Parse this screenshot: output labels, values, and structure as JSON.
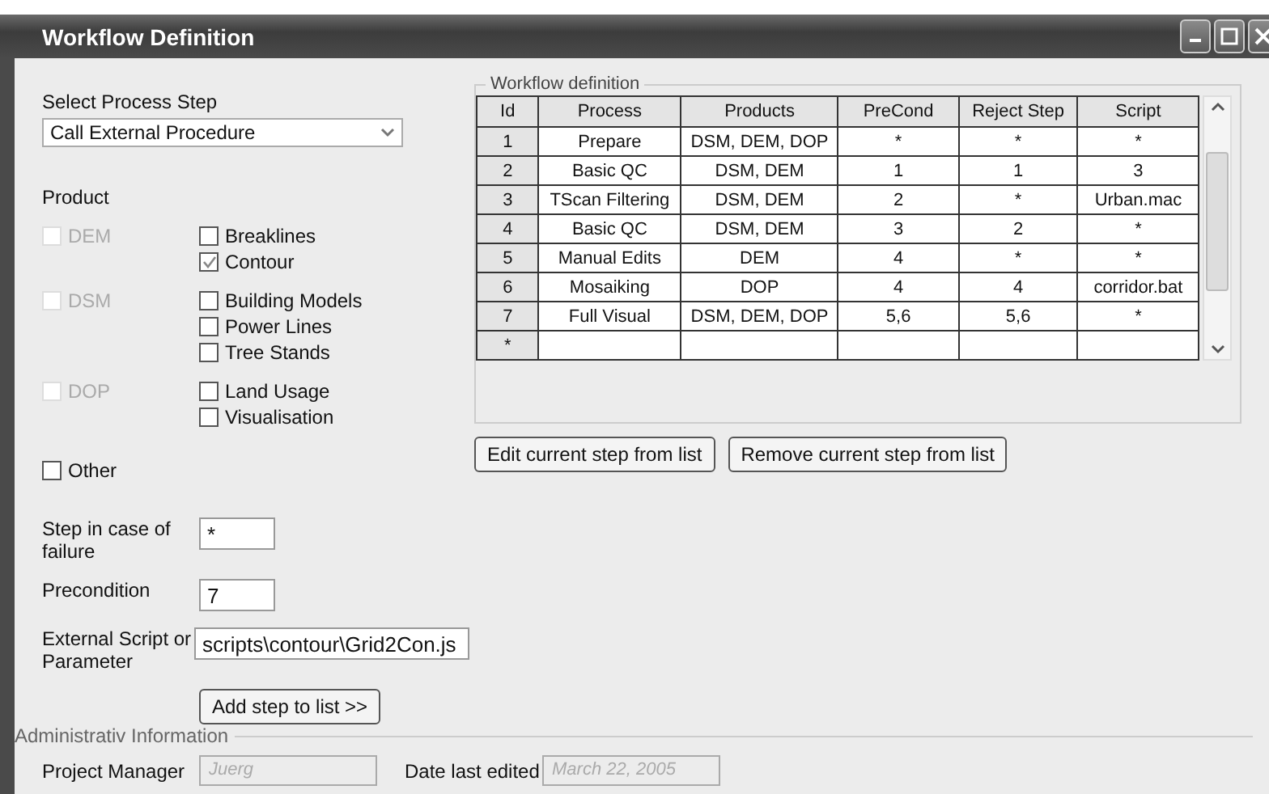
{
  "window": {
    "title": "Workflow Definition"
  },
  "process_step": {
    "label": "Select Process Step",
    "value": "Call External Procedure"
  },
  "product": {
    "label": "Product",
    "groups": [
      {
        "label": "DEM",
        "checked": false,
        "disabled": true,
        "items": [
          {
            "label": "Breaklines",
            "checked": false
          },
          {
            "label": "Contour",
            "checked": true
          }
        ]
      },
      {
        "label": "DSM",
        "checked": false,
        "disabled": true,
        "items": [
          {
            "label": "Building Models",
            "checked": false
          },
          {
            "label": "Power Lines",
            "checked": false
          },
          {
            "label": "Tree Stands",
            "checked": false
          }
        ]
      },
      {
        "label": "DOP",
        "checked": false,
        "disabled": true,
        "items": [
          {
            "label": "Land Usage",
            "checked": false
          },
          {
            "label": "Visualisation",
            "checked": false
          }
        ]
      }
    ]
  },
  "other": {
    "label": "Other",
    "checked": false
  },
  "fields": [
    {
      "label": "Step in case of failure",
      "value": "*",
      "kind": "short"
    },
    {
      "label": "Precondition",
      "value": "7",
      "kind": "short"
    },
    {
      "label": "External Script or Parameter",
      "value": "scripts\\contour\\Grid2Con.js",
      "kind": "long"
    }
  ],
  "add_button": "Add step to list >>",
  "workflow": {
    "title": "Workflow definition",
    "columns": [
      "Id",
      "Process",
      "Products",
      "PreCond",
      "Reject Step",
      "Script"
    ],
    "rows": [
      [
        "1",
        "Prepare",
        "DSM, DEM, DOP",
        "*",
        "*",
        "*"
      ],
      [
        "2",
        "Basic QC",
        "DSM, DEM",
        "1",
        "1",
        "3"
      ],
      [
        "3",
        "TScan Filtering",
        "DSM, DEM",
        "2",
        "*",
        "Urban.mac"
      ],
      [
        "4",
        "Basic QC",
        "DSM, DEM",
        "3",
        "2",
        "*"
      ],
      [
        "5",
        "Manual Edits",
        "DEM",
        "4",
        "*",
        "*"
      ],
      [
        "6",
        "Mosaiking",
        "DOP",
        "4",
        "4",
        "corridor.bat"
      ],
      [
        "7",
        "Full Visual",
        "DSM, DEM, DOP",
        "5,6",
        "5,6",
        "*"
      ]
    ],
    "new_row_marker": "*"
  },
  "buttons": [
    "Edit current step from list",
    "Remove current step from list"
  ],
  "admin": {
    "title": "Administrativ Information",
    "fields": [
      {
        "label": "Project Manager",
        "value": "Juerg"
      },
      {
        "label": "Date last edited",
        "value": "March 22, 2005"
      }
    ]
  }
}
